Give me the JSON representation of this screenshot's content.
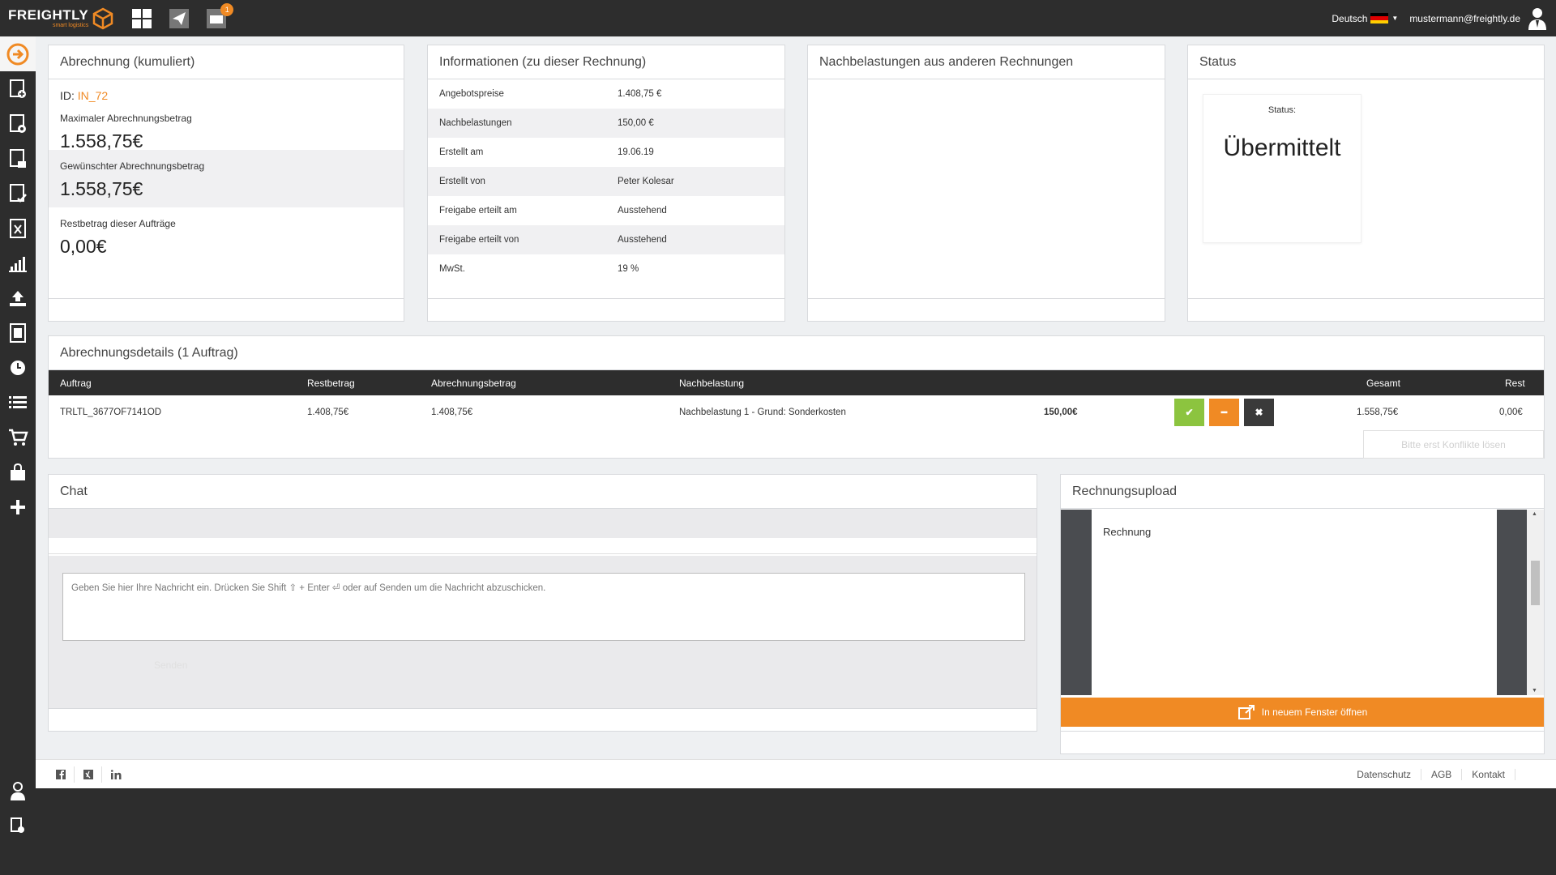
{
  "topbar": {
    "brand": "FREIGHTLY",
    "brand_sub": "smart logistics",
    "notification_count": "1",
    "language": "Deutsch",
    "user_email": "mustermann@freightly.de"
  },
  "summary": {
    "title": "Abrechnung (kumuliert)",
    "id_label": "ID:",
    "id_value": "IN_72",
    "max_label": "Maximaler Abrechnungsbetrag",
    "max_value": "1.558,75€",
    "wanted_label": "Gewünschter Abrechnungsbetrag",
    "wanted_value": "1.558,75€",
    "rest_label": "Restbetrag dieser Aufträge",
    "rest_value": "0,00€"
  },
  "info": {
    "title": "Informationen (zu dieser Rechnung)",
    "rows": [
      {
        "key": "Angebotspreise",
        "value": "1.408,75 €"
      },
      {
        "key": "Nachbelastungen",
        "value": "150,00 €"
      },
      {
        "key": "Erstellt am",
        "value": "19.06.19"
      },
      {
        "key": "Erstellt von",
        "value": "Peter Kolesar"
      },
      {
        "key": "Freigabe erteilt am",
        "value": "Ausstehend"
      },
      {
        "key": "Freigabe erteilt von",
        "value": "Ausstehend"
      },
      {
        "key": "MwSt.",
        "value": "19 %"
      }
    ]
  },
  "charges": {
    "title": "Nachbelastungen aus anderen Rechnungen"
  },
  "status": {
    "title": "Status",
    "label": "Status:",
    "value": "Übermittelt"
  },
  "details": {
    "title": "Abrechnungsdetails (1 Auftrag)",
    "columns": {
      "auftrag": "Auftrag",
      "restbetrag": "Restbetrag",
      "abrechnungsbetrag": "Abrechnungsbetrag",
      "nachbelastung": "Nachbelastung",
      "gesamt": "Gesamt",
      "rest": "Rest"
    },
    "row": {
      "auftrag": "TRLTL_3677OF7141OD",
      "restbetrag": "1.408,75€",
      "abrechnungsbetrag": "1.408,75€",
      "nachbelastung": "Nachbelastung 1 - Grund: Sonderkosten",
      "nachbelastung_betrag": "150,00€",
      "gesamt": "1.558,75€",
      "rest": "0,00€"
    },
    "conflict_button": "Bitte erst Konflikte lösen",
    "colors": {
      "approve": "#8cc43f",
      "minus": "#f08a24",
      "reject": "#3a3a3a"
    }
  },
  "chat": {
    "title": "Chat",
    "placeholder": "Geben Sie hier Ihre Nachricht ein. Drücken Sie Shift ⇧ + Enter ⏎ oder auf Senden um die Nachricht abzuschicken.",
    "send_label": "Senden"
  },
  "upload": {
    "title": "Rechnungsupload",
    "doc_title": "Rechnung",
    "open_button": "In neuem Fenster öffnen"
  },
  "footer": {
    "links": [
      "Datenschutz",
      "AGB",
      "Kontakt"
    ]
  },
  "colors": {
    "accent": "#f08a24",
    "dark": "#2d2d2d"
  }
}
